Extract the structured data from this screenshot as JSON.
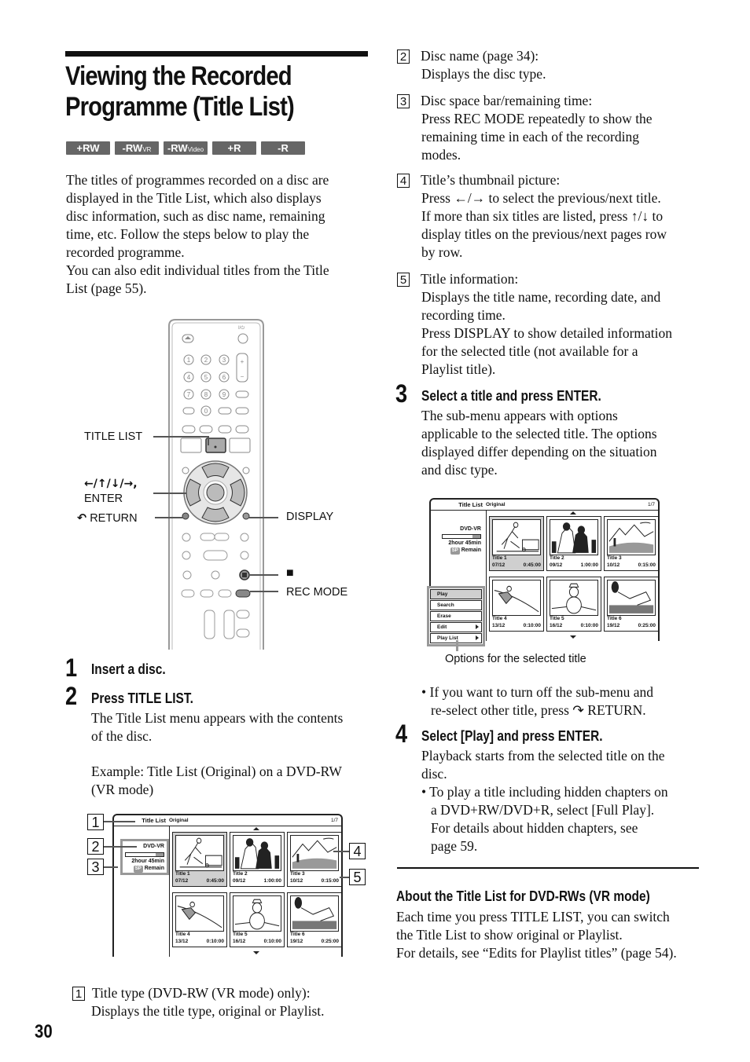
{
  "page": {
    "title_line1": "Viewing the Recorded",
    "title_line2": "Programme (Title List)",
    "page_number": "30",
    "disc_badges": [
      {
        "main": "+RW",
        "sub": ""
      },
      {
        "main": "-RW",
        "sub": "VR"
      },
      {
        "main": "-RW",
        "sub": "Video"
      },
      {
        "main": "+R",
        "sub": ""
      },
      {
        "main": "-R",
        "sub": ""
      }
    ],
    "intro_lines": [
      "The titles of programmes recorded on a disc are",
      "displayed in the Title List, which also displays",
      "disc information, such as disc name, remaining",
      "time, etc. Follow the steps below to play the",
      "recorded programme.",
      "You can also edit individual titles from the Title",
      "List (page 55)."
    ]
  },
  "remote": {
    "labels": {
      "title_list": "TITLE LIST",
      "arrows": "←/↑/↓/→,",
      "enter": "ENTER",
      "return": "RETURN",
      "display": "DISPLAY",
      "stop": "■",
      "rec_mode": "REC MODE"
    },
    "numpad": [
      "1",
      "2",
      "3",
      "4",
      "5",
      "6",
      "7",
      "8",
      "9",
      "",
      "0",
      ""
    ]
  },
  "steps": {
    "s1": {
      "num": "1",
      "head": "Insert a disc."
    },
    "s2": {
      "num": "2",
      "head": "Press TITLE LIST.",
      "body1": "The Title List menu appears with the contents",
      "body2": "of the disc.",
      "example1": "Example: Title List (Original) on a DVD-RW",
      "example2": "(VR mode)"
    },
    "s3": {
      "num": "3",
      "head": "Select a title and press ENTER.",
      "body": [
        "The sub-menu appears with options",
        "applicable to the selected title. The options",
        "displayed differ depending on the situation",
        "and disc type."
      ],
      "note1": "• If you want to turn off the sub-menu and",
      "note2": "re-select other title, press ↷ RETURN."
    },
    "s4": {
      "num": "4",
      "head": "Select [Play] and press ENTER.",
      "body1": "Playback starts from the selected title on the",
      "body2": "disc.",
      "bullet": [
        "• To play a title including hidden chapters on",
        "a DVD+RW/DVD+R, select [Full Play].",
        "For details about hidden chapters, see",
        "page 59."
      ]
    }
  },
  "callouts": [
    {
      "num": "1",
      "head": "Title type (DVD-RW (VR mode) only):",
      "body": [
        "Displays the title type, original or Playlist."
      ]
    },
    {
      "num": "2",
      "head": "Disc name (page 34):",
      "body": [
        "Displays the disc type."
      ]
    },
    {
      "num": "3",
      "head": "Disc space bar/remaining time:",
      "body": [
        "Press REC MODE repeatedly to show the",
        "remaining time in each of the recording",
        "modes."
      ]
    },
    {
      "num": "4",
      "head": "Title’s thumbnail picture:",
      "body": [
        "Press ←/→ to select the previous/next title.",
        "If more than six titles are listed, press ↑/↓ to",
        "display titles on the previous/next pages row",
        "by row."
      ]
    },
    {
      "num": "5",
      "head": "Title information:",
      "body": [
        "Displays the title name, recording date, and",
        "recording time.",
        "Press DISPLAY to show detailed information",
        "for the selected title (not available for a",
        "Playlist title)."
      ]
    }
  ],
  "title_list_screen": {
    "header_label": "Title List",
    "title_type": "Original",
    "page_indicator": "1/7",
    "disc_name": "DVD-VR",
    "disc_used_fraction": 0.2,
    "remaining_time": "2hour 45min",
    "rec_mode": "SP",
    "remain_label": "Remain",
    "titles": [
      {
        "name": "Title 1",
        "date": "07/12",
        "time": "0:45:00",
        "selected": true
      },
      {
        "name": "Title 2",
        "date": "09/12",
        "time": "1:00:00",
        "selected": false
      },
      {
        "name": "Title 3",
        "date": "10/12",
        "time": "0:15:00",
        "selected": false
      },
      {
        "name": "Title 4",
        "date": "13/12",
        "time": "0:10:00",
        "selected": false
      },
      {
        "name": "Title 5",
        "date": "16/12",
        "time": "0:10:00",
        "selected": false
      },
      {
        "name": "Title 6",
        "date": "19/12",
        "time": "0:25:00",
        "selected": false
      }
    ],
    "submenu": [
      {
        "label": "Play",
        "selected": true,
        "submenu": false
      },
      {
        "label": "Search",
        "selected": false,
        "submenu": false
      },
      {
        "label": "Erase",
        "selected": false,
        "submenu": false
      },
      {
        "label": "Edit",
        "selected": false,
        "submenu": true
      },
      {
        "label": "Play List",
        "selected": false,
        "submenu": true
      }
    ],
    "submenu_caption": "Options for the selected title"
  },
  "about": {
    "heading": "About the Title List for DVD-RWs (VR mode)",
    "lines": [
      "Each time you press TITLE LIST, you can switch",
      "the Title List to show original or Playlist.",
      "For details, see “Edits for Playlist titles” (page 54)."
    ]
  }
}
